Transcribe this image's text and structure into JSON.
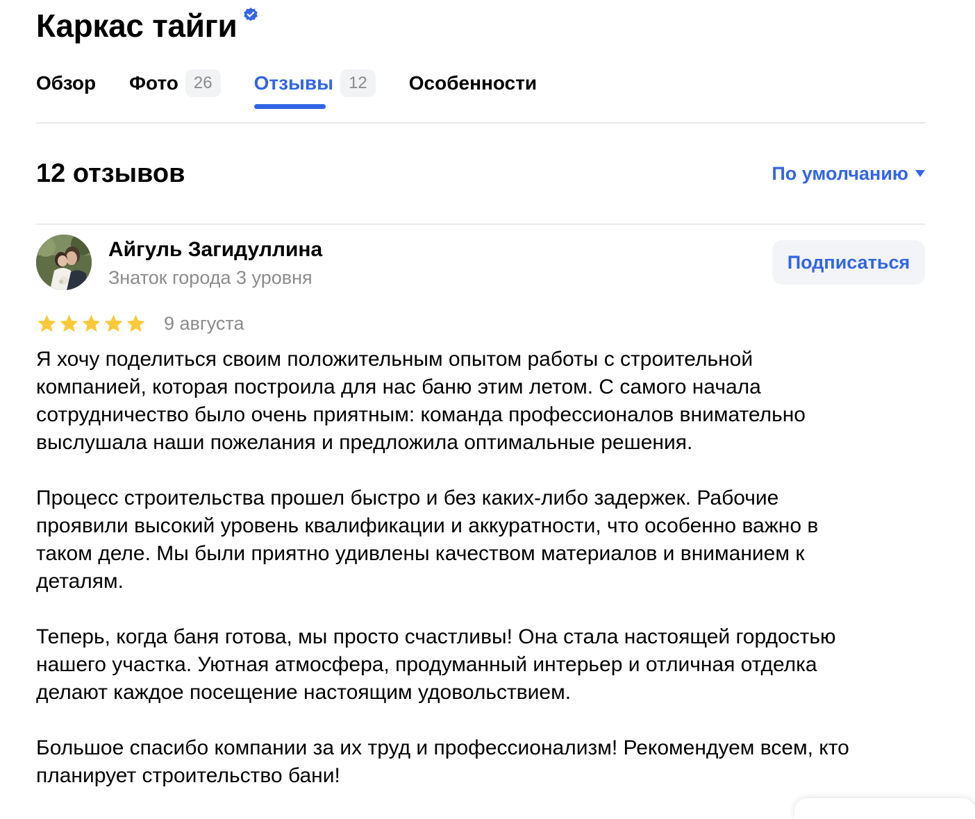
{
  "company": {
    "name": "Каркас тайги",
    "verified_icon": "verified-check-icon"
  },
  "tabs": [
    {
      "label": "Обзор",
      "count": null,
      "active": false
    },
    {
      "label": "Фото",
      "count": "26",
      "active": false
    },
    {
      "label": "Отзывы",
      "count": "12",
      "active": true
    },
    {
      "label": "Особенности",
      "count": null,
      "active": false
    }
  ],
  "reviews_header": {
    "count_label": "12 отзывов",
    "sort_label": "По умолчанию"
  },
  "review": {
    "author_name": "Айгуль Загидуллина",
    "author_level": "Знаток города 3 уровня",
    "subscribe_label": "Подписаться",
    "rating": 5,
    "rating_max": 5,
    "date": "9 августа",
    "paragraphs": [
      "Я хочу поделиться своим положительным опытом работы с строительной\nкомпанией, которая построила для нас баню этим летом. С самого начала\nсотрудничество было очень приятным: команда профессионалов внимательно\nвыслушала наши пожелания и предложила оптимальные решения.",
      "Процесс строительства прошел быстро и без каких-либо задержек. Рабочие\nпроявили высокий уровень квалификации и аккуратности, что особенно важно в\nтаком деле. Мы были приятно удивлены качеством материалов и вниманием к\nдеталям.",
      "Теперь, когда баня готова, мы просто счастливы! Она стала настоящей гордостью\nнашего участка. Уютная атмосфера, продуманный интерьер и отличная отделка\nделают каждое посещение настоящим удовольствием.",
      "Большое спасибо компании за их труд и профессионализм! Рекомендуем всем, кто\nпланирует строительство бани!"
    ]
  },
  "colors": {
    "accent": "#3366e6",
    "star": "#fcc937",
    "muted_text": "#8c8c8c",
    "chip_bg": "#f2f3f5",
    "divider": "#e9eaed"
  }
}
